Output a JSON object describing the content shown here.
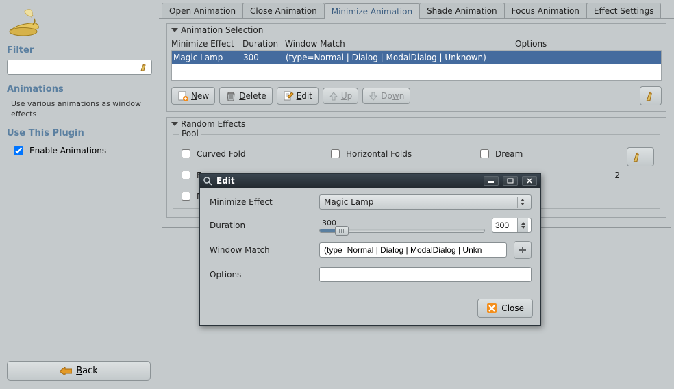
{
  "sidebar": {
    "filter_heading": "Filter",
    "animations_heading": "Animations",
    "animations_desc": "Use various animations as window effects",
    "use_plugin_heading": "Use This Plugin",
    "enable_label": "Enable Animations",
    "enable_checked": true,
    "back_label": "Back"
  },
  "tabs": [
    {
      "label": "Open Animation"
    },
    {
      "label": "Close Animation"
    },
    {
      "label": "Minimize Animation"
    },
    {
      "label": "Shade Animation"
    },
    {
      "label": "Focus Animation"
    },
    {
      "label": "Effect Settings"
    }
  ],
  "active_tab": 2,
  "anim_group": {
    "title": "Animation Selection",
    "columns": {
      "c0": "Minimize Effect",
      "c1": "Duration",
      "c2": "Window Match",
      "c3": "Options"
    },
    "row": {
      "effect": "Magic Lamp",
      "duration": "300",
      "match": "(type=Normal | Dialog | ModalDialog | Unknown)",
      "options": ""
    },
    "buttons": {
      "new": "New",
      "delete": "Delete",
      "edit": "Edit",
      "up": "Up",
      "down": "Down"
    }
  },
  "random": {
    "title": "Random Effects",
    "pool_label": "Pool",
    "items": [
      [
        {
          "label": "Curved Fold"
        },
        {
          "label": "Horizontal Folds"
        },
        {
          "label": "Dream"
        }
      ],
      [
        {
          "label": "F"
        },
        {
          "label": ""
        },
        {
          "label": "2"
        }
      ],
      [
        {
          "label": "M"
        },
        {
          "label": ""
        },
        {
          "label": ""
        }
      ]
    ]
  },
  "modal": {
    "title": "Edit",
    "labels": {
      "effect": "Minimize Effect",
      "duration": "Duration",
      "match": "Window Match",
      "options": "Options"
    },
    "effect_value": "Magic Lamp",
    "duration_value": "300",
    "slider_top": "300",
    "match_value": "(type=Normal | Dialog | ModalDialog | Unkn",
    "options_value": "",
    "close_label": "Close"
  }
}
